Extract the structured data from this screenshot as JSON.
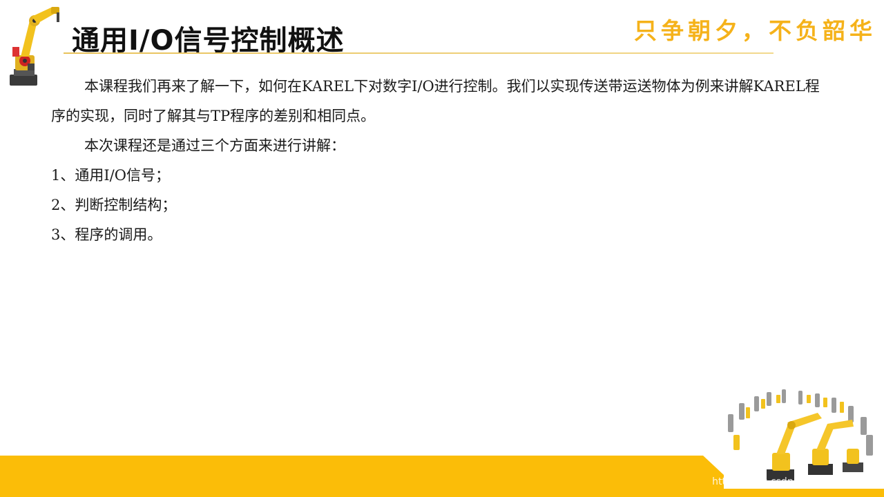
{
  "slide": {
    "title": "通用I/O信号控制概述",
    "slogan": "只争朝夕，不负韶华",
    "paragraph1": "本课程我们再来了解一下，如何在KAREL下对数字I/O进行控制。我们以实现传送带运送物体为例来讲解KAREL程序的实现，同时了解其与TP程序的差别和相同点。",
    "paragraph2": "本次课程还是通过三个方面来进行讲解：",
    "items": [
      "1、通用I/O信号；",
      "2、判断控制结构；",
      "3、程序的调用。"
    ],
    "watermark": "https://blog.csdn.net/haier123888"
  },
  "colors": {
    "accent": "#f5b21a",
    "band": "#fbbd08",
    "rule": "#e8c25a"
  },
  "icons": {
    "logo": "industrial-robot-arm-icon",
    "decoration": "robot-cluster-icon"
  }
}
